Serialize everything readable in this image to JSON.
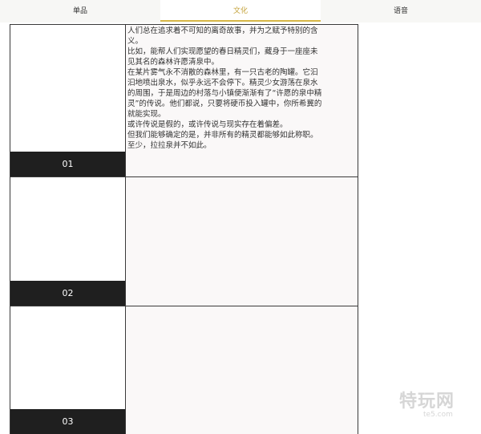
{
  "tabs": [
    {
      "label": "单品"
    },
    {
      "label": "文化"
    },
    {
      "label": "语音"
    }
  ],
  "active_tab_color": "#c4a33c",
  "entries": [
    {
      "number": "01",
      "lines": [
        "人们总在追求着不可知的离奇故事，并为之赋予特别的含义。",
        "比如，能帮人们实现愿望的春日精灵们，藏身于一座座未见其名的森林许愿清泉中。",
        "在某片雾气永不消散的森林里，有一只古老的陶罐。它汩汩地喷出泉水，似乎永远不会停下。精灵少女游荡在泉水的周围，于是周边的村落与小镇便渐渐有了“许愿的泉中精灵”的传说。他们都说，只要将硬币投入罐中，你所希冀的就能实现。",
        "或许传说是假的，或许传说与现实存在着偏差。",
        "但我们能够确定的是，并非所有的精灵都能够如此称职。",
        "至少，拉拉泉并不如此。"
      ]
    },
    {
      "number": "02"
    },
    {
      "number": "03"
    }
  ],
  "watermark": {
    "text": "特玩网",
    "url": "te5.com"
  }
}
